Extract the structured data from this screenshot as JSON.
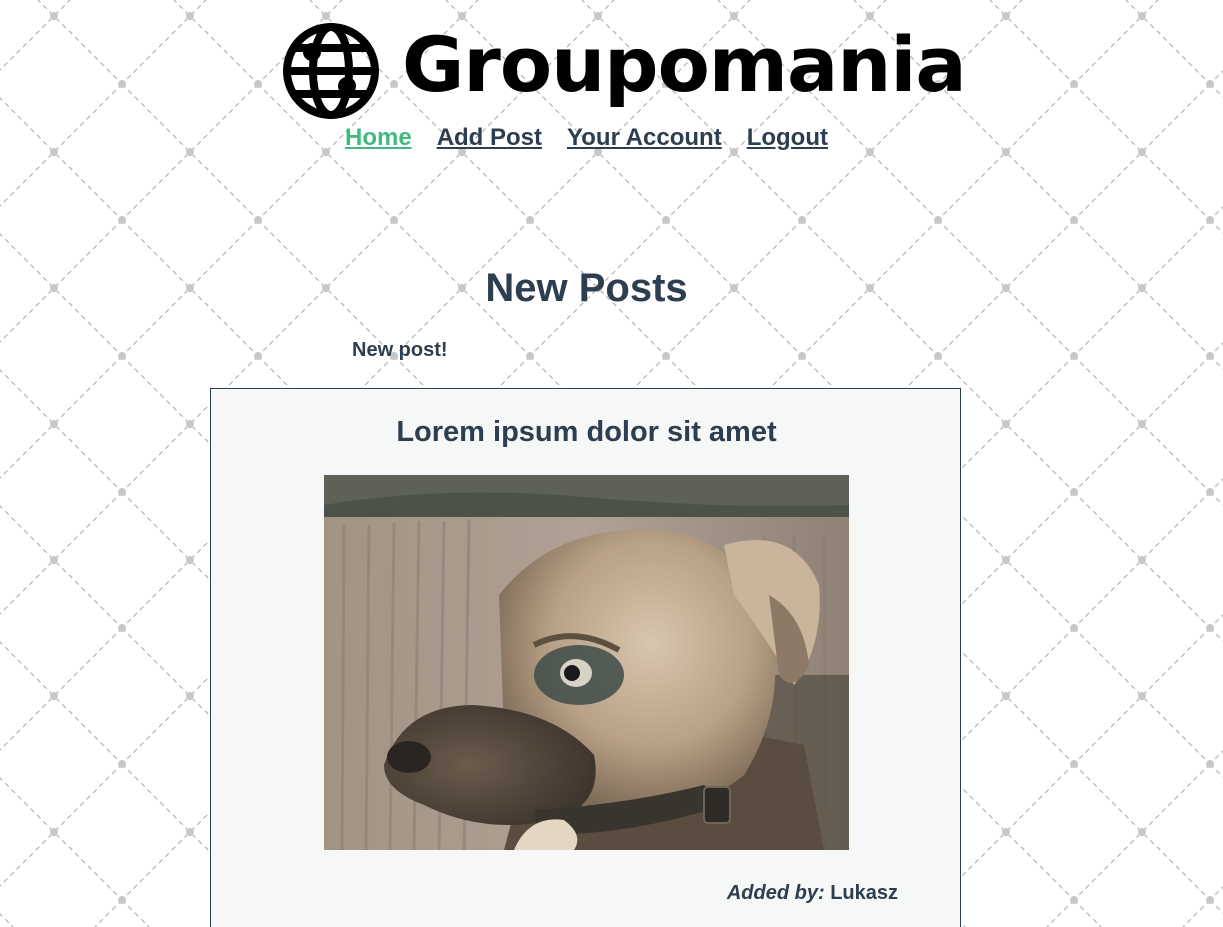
{
  "app": {
    "logo_text": "Groupomania",
    "logo_icon": "globe-icon"
  },
  "nav": {
    "items": [
      {
        "label": "Home",
        "active": true
      },
      {
        "label": "Add Post",
        "active": false
      },
      {
        "label": "Your Account",
        "active": false
      },
      {
        "label": "Logout",
        "active": false
      }
    ]
  },
  "main": {
    "title": "New Posts",
    "new_post_link": "New post!"
  },
  "posts": [
    {
      "title": "Lorem ipsum dolor sit amet",
      "image_description": "dog-gif",
      "added_by_label": "Added by:",
      "author": "Lukasz"
    }
  ],
  "colors": {
    "text": "#2c3e50",
    "active_link": "#42b983",
    "card_bg": "#f6f7f7"
  }
}
